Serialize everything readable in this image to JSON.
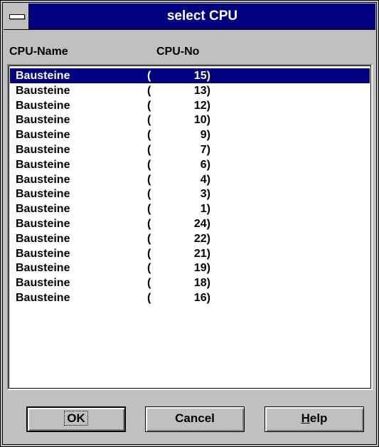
{
  "window": {
    "title": "select CPU"
  },
  "columns": {
    "name": "CPU-Name",
    "number": "CPU-No"
  },
  "rows": [
    {
      "name": "Bausteine",
      "open": "(",
      "number": "15)"
    },
    {
      "name": "Bausteine",
      "open": "(",
      "number": "13)"
    },
    {
      "name": "Bausteine",
      "open": "(",
      "number": "12)"
    },
    {
      "name": "Bausteine",
      "open": "(",
      "number": "10)"
    },
    {
      "name": "Bausteine",
      "open": "(",
      "number": "9)"
    },
    {
      "name": "Bausteine",
      "open": "(",
      "number": "7)"
    },
    {
      "name": "Bausteine",
      "open": "(",
      "number": "6)"
    },
    {
      "name": "Bausteine",
      "open": "(",
      "number": "4)"
    },
    {
      "name": "Bausteine",
      "open": "(",
      "number": "3)"
    },
    {
      "name": "Bausteine",
      "open": "(",
      "number": "1)"
    },
    {
      "name": "Bausteine",
      "open": "(",
      "number": "24)"
    },
    {
      "name": "Bausteine",
      "open": "(",
      "number": "22)"
    },
    {
      "name": "Bausteine",
      "open": "(",
      "number": "21)"
    },
    {
      "name": "Bausteine",
      "open": "(",
      "number": "19)"
    },
    {
      "name": "Bausteine",
      "open": "(",
      "number": "18)"
    },
    {
      "name": "Bausteine",
      "open": "(",
      "number": "16)"
    }
  ],
  "selected_row": 0,
  "buttons": {
    "ok": "OK",
    "cancel": "Cancel",
    "help_mnemonic": "H",
    "help_rest": "elp"
  },
  "icons": {
    "system_menu": "system-menu-icon"
  },
  "colors": {
    "titlebar": "#000080",
    "selection": "#000080",
    "face": "#c0c0c0"
  }
}
